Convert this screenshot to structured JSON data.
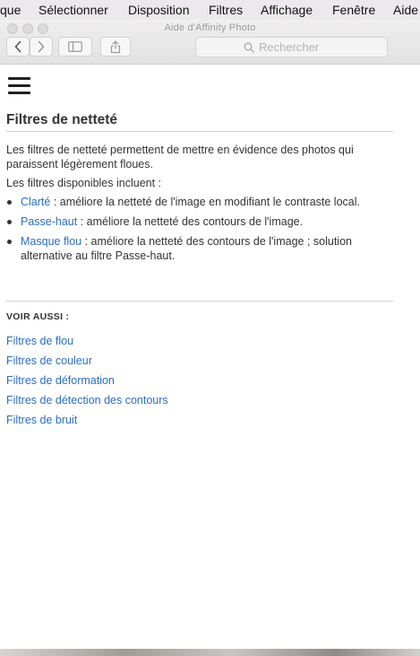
{
  "menubar": {
    "items": [
      "que",
      "Sélectionner",
      "Disposition",
      "Filtres",
      "Affichage",
      "Fenêtre",
      "Aide"
    ]
  },
  "window": {
    "title": "Aide d'Affinity Photo",
    "search_placeholder": "Rechercher"
  },
  "icons": {
    "back": "chevron-left-icon",
    "forward": "chevron-right-icon",
    "sidebar": "sidebar-icon",
    "share": "share-icon",
    "search": "search-icon",
    "menu": "hamburger-menu-icon"
  },
  "colors": {
    "link": "#2b6cc4",
    "text": "#333333",
    "heading": "#333333"
  },
  "page": {
    "title": "Filtres de netteté",
    "intro": "Les filtres de netteté permettent de mettre en évidence des photos qui paraissent légèrement floues.",
    "available": "Les filtres disponibles incluent :",
    "filters": [
      {
        "name": "Clarté",
        "description": " : améliore la netteté de l'image en modifiant le contraste local."
      },
      {
        "name": "Passe-haut",
        "description": " : améliore la netteté des contours de l'image."
      },
      {
        "name": "Masque flou",
        "description": " : améliore la netteté des contours de l'image ; solution alternative au filtre Passe-haut."
      }
    ],
    "see_also_heading": "VOIR AUSSI :",
    "see_also": [
      "Filtres de flou",
      "Filtres de couleur",
      "Filtres de déformation",
      "Filtres de détection des contours",
      "Filtres de bruit"
    ]
  }
}
